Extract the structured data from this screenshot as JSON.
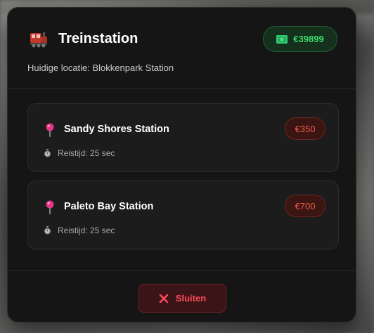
{
  "header": {
    "title": "Treinstation",
    "title_icon": "train-icon",
    "location": "Huidige locatie: Blokkenpark Station",
    "balance": "€39899",
    "balance_icon": "money-icon"
  },
  "stations": [
    {
      "name": "Sandy Shores Station",
      "price": "€350",
      "travel_time": "Reistijd: 25 sec",
      "icon": "pin-icon"
    },
    {
      "name": "Paleto Bay Station",
      "price": "€700",
      "travel_time": "Reistijd: 25 sec",
      "icon": "pin-icon"
    }
  ],
  "footer": {
    "close_label": "Sluiten",
    "close_icon": "close-icon"
  },
  "colors": {
    "balance": "#3ddc6c",
    "price": "#f05a45",
    "close": "#ff4a5b",
    "pin": "#e8358a"
  }
}
